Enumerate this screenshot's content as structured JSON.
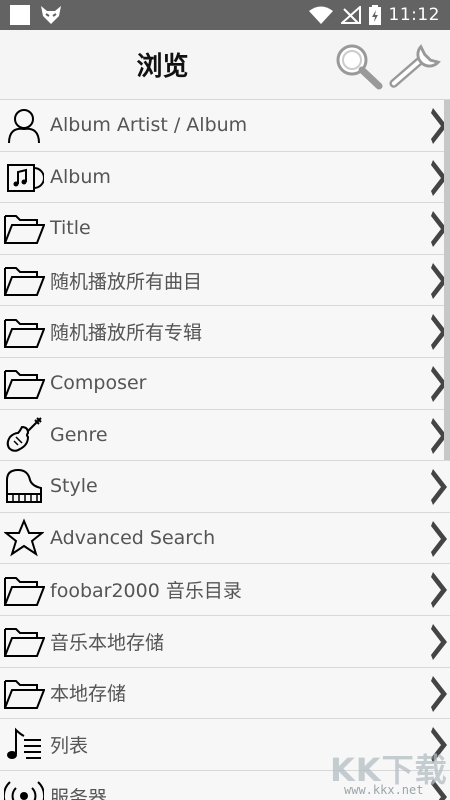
{
  "status": {
    "time": "11:12"
  },
  "header": {
    "title": "浏览"
  },
  "rows": [
    {
      "label": "Album Artist / Album",
      "icon": "person-icon"
    },
    {
      "label": "Album",
      "icon": "album-icon"
    },
    {
      "label": "Title",
      "icon": "folder-icon"
    },
    {
      "label": "随机播放所有曲目",
      "icon": "folder-icon"
    },
    {
      "label": "随机播放所有专辑",
      "icon": "folder-icon"
    },
    {
      "label": "Composer",
      "icon": "folder-icon"
    },
    {
      "label": "Genre",
      "icon": "violin-icon"
    },
    {
      "label": "Style",
      "icon": "piano-icon"
    },
    {
      "label": "Advanced Search",
      "icon": "star-icon"
    },
    {
      "label": "foobar2000 音乐目录",
      "icon": "folder-icon"
    },
    {
      "label": "音乐本地存储",
      "icon": "folder-icon"
    },
    {
      "label": "本地存储",
      "icon": "folder-icon"
    },
    {
      "label": "列表",
      "icon": "playlist-icon"
    },
    {
      "label": "服务器",
      "icon": "server-icon"
    }
  ],
  "watermark": {
    "text": "KK下载",
    "url": "www.kkx.net"
  }
}
